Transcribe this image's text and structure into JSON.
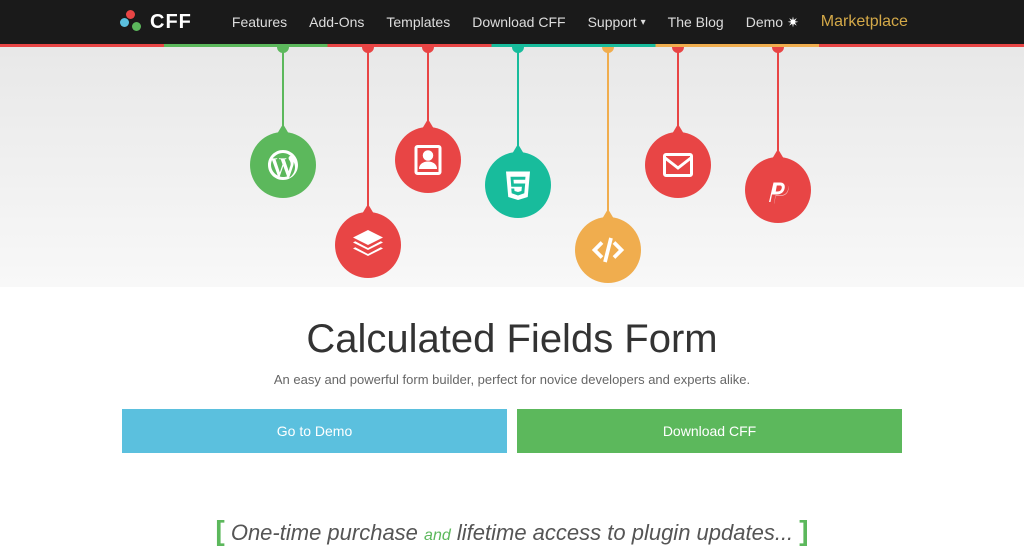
{
  "brand": "CFF",
  "nav": {
    "features": "Features",
    "addons": "Add-Ons",
    "templates": "Templates",
    "download": "Download CFF",
    "support": "Support",
    "blog": "The Blog",
    "demo": "Demo",
    "marketplace": "Marketplace"
  },
  "hero": {
    "title": "Calculated Fields Form",
    "subtitle": "An easy and powerful form builder, perfect for novice developers and experts alike."
  },
  "buttons": {
    "demo": "Go to Demo",
    "download": "Download CFF"
  },
  "slogan": {
    "part1": "One-time purchase",
    "and": "and",
    "part2": "lifetime access to plugin updates..."
  },
  "colors": {
    "green": "#5cb85c",
    "red": "#e84545",
    "teal": "#18bc9c",
    "orange": "#f0ad4e",
    "blue": "#5bc0de"
  }
}
